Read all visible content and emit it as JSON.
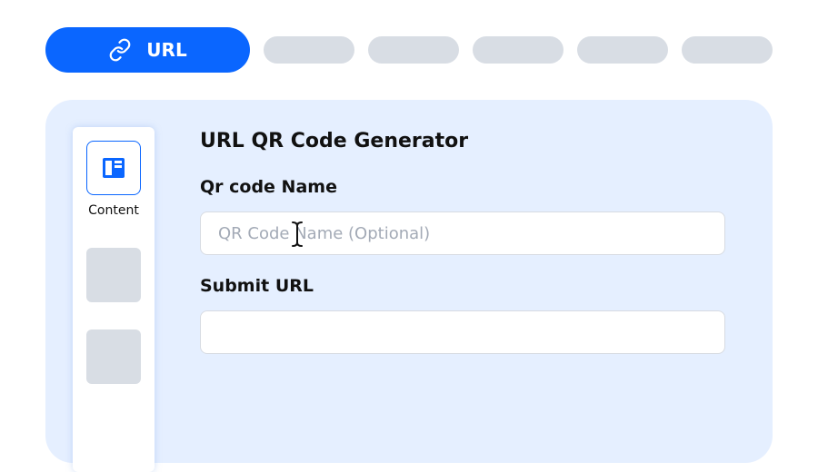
{
  "tabs": {
    "active_label": "URL",
    "active_icon": "link-icon",
    "inactive_count_note": ""
  },
  "sidebar": {
    "active_item_label": "Content",
    "active_item_icon": "content-layout-icon"
  },
  "form": {
    "title": "URL QR Code Generator",
    "name_label": "Qr code Name",
    "name_placeholder": "QR Code Name (Optional)",
    "name_value": "",
    "url_label": "Submit URL",
    "url_placeholder": "",
    "url_value": ""
  },
  "colors": {
    "accent": "#0a66ff",
    "panel_bg": "#e5efff",
    "placeholder_gray": "#d8dde4"
  }
}
